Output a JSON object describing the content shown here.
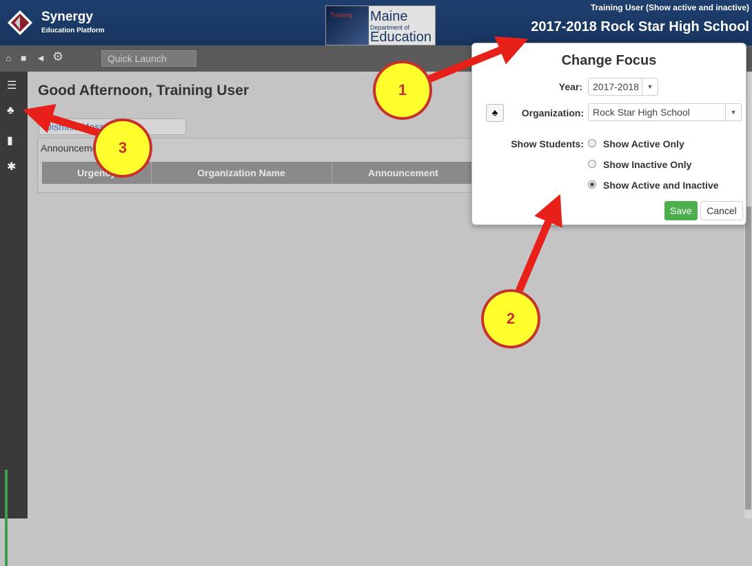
{
  "header": {
    "app_name": "Synergy",
    "app_sub": "Education Platform",
    "dept_training": "Training",
    "dept_l1": "Maine",
    "dept_l2": "Department of",
    "dept_l3": "Education",
    "user_line": "Training User (Show active and inactive)",
    "school_line": "2017-2018 Rock Star High School"
  },
  "toolbar": {
    "quick_launch_placeholder": "Quick Launch"
  },
  "main": {
    "greeting": "Good Afternoon, Training User",
    "dismiss_label": "Dismiss Messages",
    "announcements_title": "Announcements",
    "columns": [
      "Urgency",
      "Organization Name",
      "Announcement"
    ]
  },
  "focus": {
    "title": "Change Focus",
    "year_label": "Year:",
    "year_value": "2017-2018",
    "org_label": "Organization:",
    "org_value": "Rock Star High School",
    "students_label": "Show Students:",
    "options": [
      "Show Active Only",
      "Show Inactive Only",
      "Show Active and Inactive"
    ],
    "selected_option": "Show Active and Inactive",
    "save": "Save",
    "cancel": "Cancel"
  },
  "annotations": [
    "1",
    "2",
    "3"
  ],
  "colors": {
    "header": "#1f3f6e",
    "save": "#4cae4c",
    "callout_fill": "#ffff2e",
    "callout_red": "#e8201a"
  }
}
